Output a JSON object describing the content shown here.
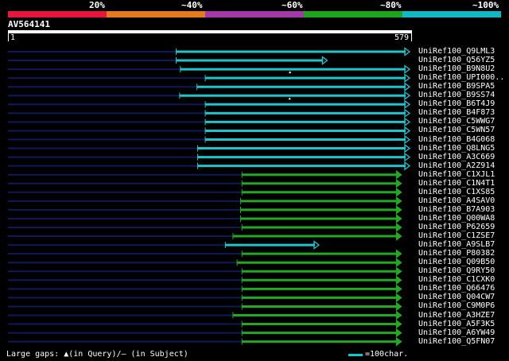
{
  "identity_scale": {
    "labels": [
      "20%",
      "~40%",
      "~60%",
      "~80%",
      "~100%"
    ],
    "colors": [
      "#e6173a",
      "#e67a1e",
      "#a33aa8",
      "#1ea51e",
      "#12b8c4"
    ]
  },
  "query": {
    "name": "AV564141",
    "start_label": "1",
    "end_label": "579",
    "length": 579
  },
  "colors": {
    "cyan": "#1fc5cc",
    "green": "#22a822",
    "unaligned": "#0e1a5a"
  },
  "hits": [
    {
      "name": "UniRef100_Q9LML3",
      "start": 243,
      "end": 579,
      "color": "cyan"
    },
    {
      "name": "UniRef100_Q56YZ5",
      "start": 243,
      "end": 460,
      "color": "cyan"
    },
    {
      "name": "UniRef100_B9N8U2",
      "start": 249,
      "end": 579,
      "color": "cyan",
      "gap": "query"
    },
    {
      "name": "UniRef100_UPI000..",
      "start": 285,
      "end": 579,
      "color": "cyan"
    },
    {
      "name": "UniRef100_B9SPA5",
      "start": 273,
      "end": 579,
      "color": "cyan"
    },
    {
      "name": "UniRef100_B9SS74",
      "start": 248,
      "end": 579,
      "color": "cyan",
      "gap": "query"
    },
    {
      "name": "UniRef100_B6T4J9",
      "start": 285,
      "end": 579,
      "color": "cyan"
    },
    {
      "name": "UniRef100_B4F873",
      "start": 285,
      "end": 579,
      "color": "cyan"
    },
    {
      "name": "UniRef100_C5WWG7",
      "start": 285,
      "end": 579,
      "color": "cyan"
    },
    {
      "name": "UniRef100_C5WN57",
      "start": 285,
      "end": 579,
      "color": "cyan"
    },
    {
      "name": "UniRef100_B4G068",
      "start": 285,
      "end": 579,
      "color": "cyan"
    },
    {
      "name": "UniRef100_Q8LNG5",
      "start": 274,
      "end": 579,
      "color": "cyan"
    },
    {
      "name": "UniRef100_A3C669",
      "start": 274,
      "end": 579,
      "color": "cyan"
    },
    {
      "name": "UniRef100_A2Z914",
      "start": 274,
      "end": 579,
      "color": "cyan"
    },
    {
      "name": "UniRef100_C1XJL1",
      "start": 338,
      "end": 567,
      "color": "green"
    },
    {
      "name": "UniRef100_C1N4T1",
      "start": 338,
      "end": 567,
      "color": "green"
    },
    {
      "name": "UniRef100_C1XS85",
      "start": 338,
      "end": 567,
      "color": "green"
    },
    {
      "name": "UniRef100_A4SAV0",
      "start": 336,
      "end": 567,
      "color": "green"
    },
    {
      "name": "UniRef100_B7A903",
      "start": 336,
      "end": 567,
      "color": "green"
    },
    {
      "name": "UniRef100_Q00WA8",
      "start": 336,
      "end": 567,
      "color": "green"
    },
    {
      "name": "UniRef100_P62659",
      "start": 338,
      "end": 567,
      "color": "green"
    },
    {
      "name": "UniRef100_C1ZSE7",
      "start": 325,
      "end": 567,
      "color": "green"
    },
    {
      "name": "UniRef100_A9SLB7",
      "start": 314,
      "end": 448,
      "color": "cyan"
    },
    {
      "name": "UniRef100_P80382",
      "start": 338,
      "end": 567,
      "color": "green"
    },
    {
      "name": "UniRef100_Q09B50",
      "start": 331,
      "end": 567,
      "color": "green"
    },
    {
      "name": "UniRef100_Q9RY50",
      "start": 338,
      "end": 567,
      "color": "green"
    },
    {
      "name": "UniRef100_C1CXK0",
      "start": 338,
      "end": 567,
      "color": "green"
    },
    {
      "name": "UniRef100_Q66476",
      "start": 338,
      "end": 567,
      "color": "green"
    },
    {
      "name": "UniRef100_Q04CW7",
      "start": 338,
      "end": 567,
      "color": "green"
    },
    {
      "name": "UniRef100_C9M0P6",
      "start": 338,
      "end": 567,
      "color": "green"
    },
    {
      "name": "UniRef100_A3HZE7",
      "start": 325,
      "end": 567,
      "color": "green"
    },
    {
      "name": "UniRef100_A5F3K5",
      "start": 338,
      "end": 567,
      "color": "green"
    },
    {
      "name": "UniRef100_A6YW49",
      "start": 338,
      "end": 567,
      "color": "green"
    },
    {
      "name": "UniRef100_Q5FN07",
      "start": 338,
      "end": 567,
      "color": "green"
    }
  ],
  "legend": {
    "gaps_text": "Large gaps: ▲(in Query)/– (in Subject)",
    "scale_text": "=100char."
  }
}
